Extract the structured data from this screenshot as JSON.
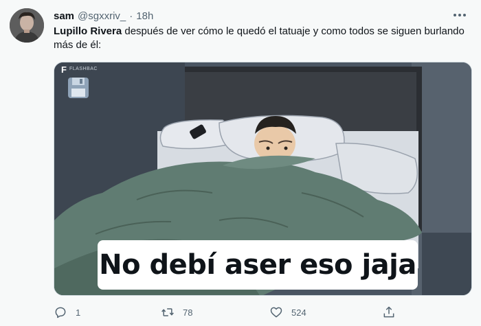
{
  "tweet": {
    "author_name": "sam",
    "author_handle": "@sgxxriv_",
    "separator": "·",
    "time": "18h",
    "text_bold": "Lupillo Rivera",
    "text_rest": " después de ver cómo le quedó el tatuaje y como todos se siguen burlando más de él:"
  },
  "media": {
    "caption": "No debí aser eso jaja",
    "watermark_logo": "F",
    "watermark_text": "FLASHBAC"
  },
  "actions": {
    "reply_count": "1",
    "retweet_count": "78",
    "like_count": "524"
  },
  "icons": {
    "more": "more-dots-icon",
    "reply": "reply-icon",
    "retweet": "retweet-icon",
    "like": "heart-icon",
    "share": "share-icon",
    "save": "floppy-disk-icon"
  },
  "colors": {
    "background": "#f7f9f9",
    "muted": "#536471",
    "text": "#0f1419"
  }
}
